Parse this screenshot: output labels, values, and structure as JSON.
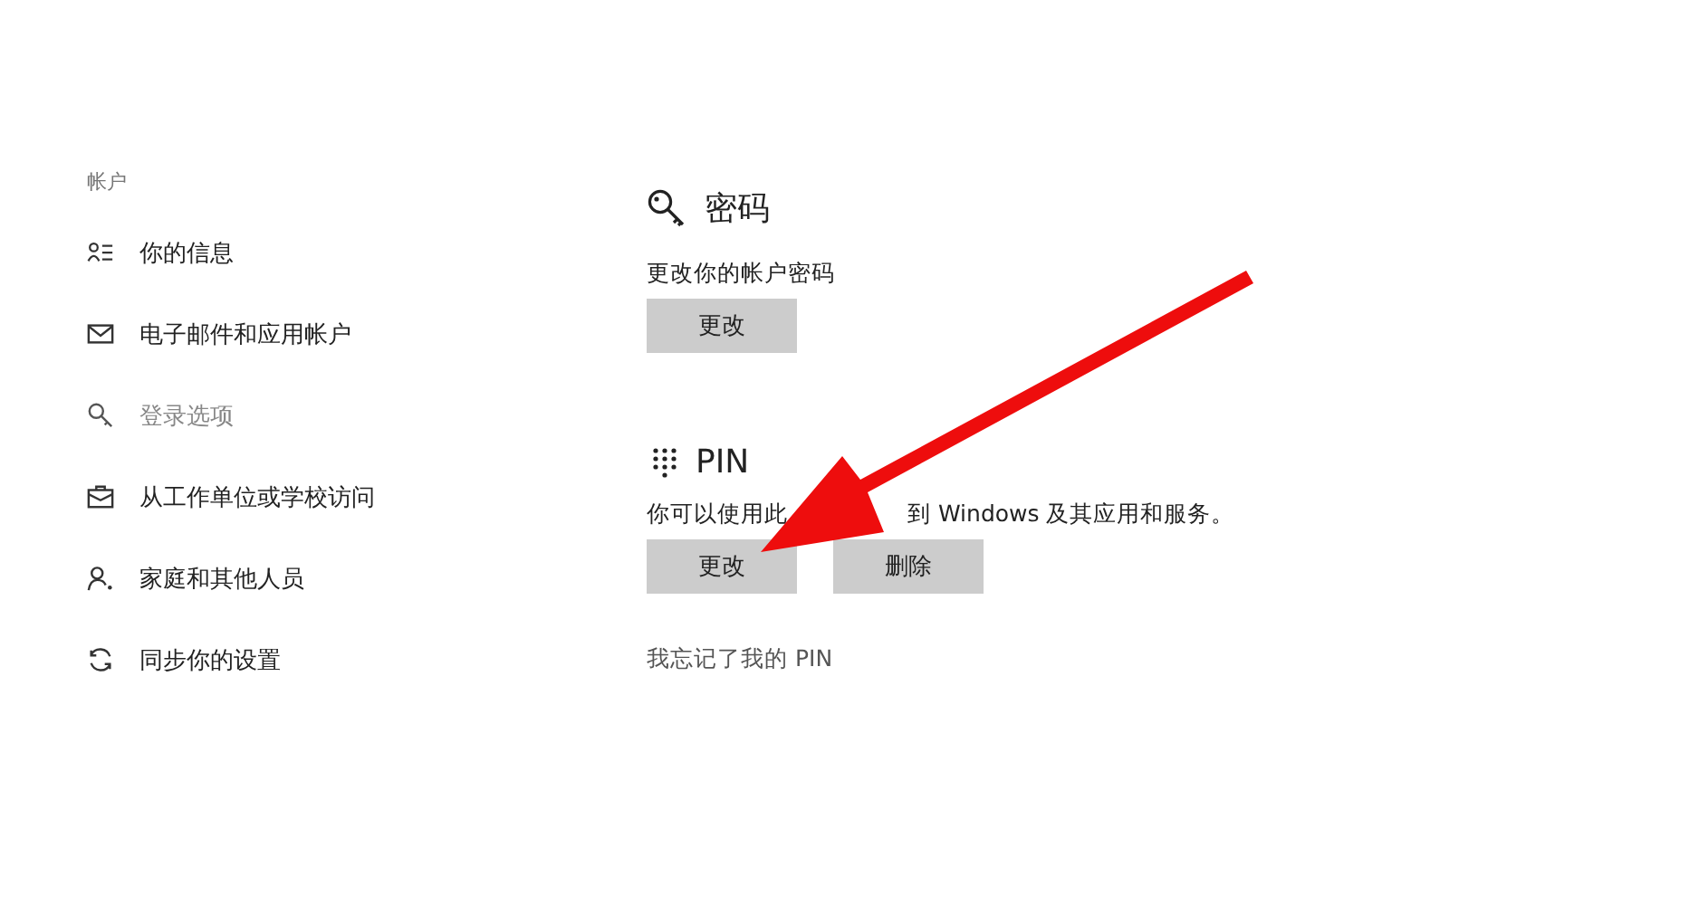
{
  "sidebar": {
    "heading": "帐户",
    "items": [
      {
        "kind": "info",
        "label": "你的信息",
        "selected": false
      },
      {
        "kind": "email",
        "label": "电子邮件和应用帐户",
        "selected": false
      },
      {
        "kind": "signin",
        "label": "登录选项",
        "selected": true
      },
      {
        "kind": "work",
        "label": "从工作单位或学校访问",
        "selected": false
      },
      {
        "kind": "family",
        "label": "家庭和其他人员",
        "selected": false
      },
      {
        "kind": "sync",
        "label": "同步你的设置",
        "selected": false
      }
    ]
  },
  "password": {
    "title": "密码",
    "description": "更改你的帐户密码",
    "buttons": [
      "更改"
    ]
  },
  "pin": {
    "title": "PIN",
    "description_parts": [
      "你可以使用此",
      "到 Windows 及其应用和服务。"
    ],
    "buttons": [
      "更改",
      "删除"
    ],
    "link": "我忘记了我的 PIN"
  },
  "annotations": [
    {
      "kind": "arrow"
    }
  ]
}
